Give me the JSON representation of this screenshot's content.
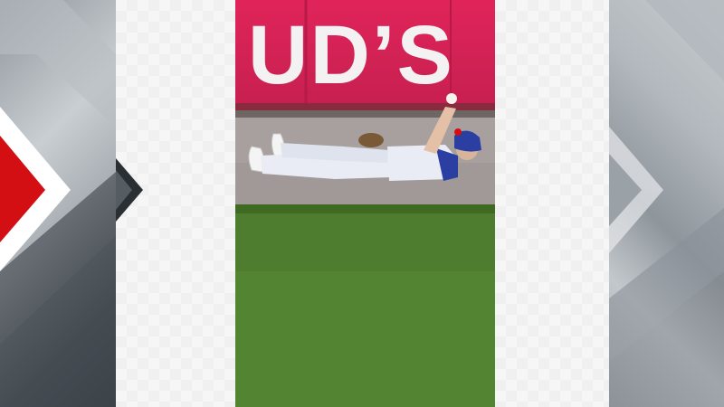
{
  "scene": {
    "wall_sign_text": "UD’S",
    "colors": {
      "wall": "#e0245a",
      "warning_track": "#a8a09e",
      "grass": "#4f7d2f",
      "uniform": "#e9ecf4",
      "cap": "#2b3fa3",
      "accent_red": "#d40f14"
    }
  }
}
